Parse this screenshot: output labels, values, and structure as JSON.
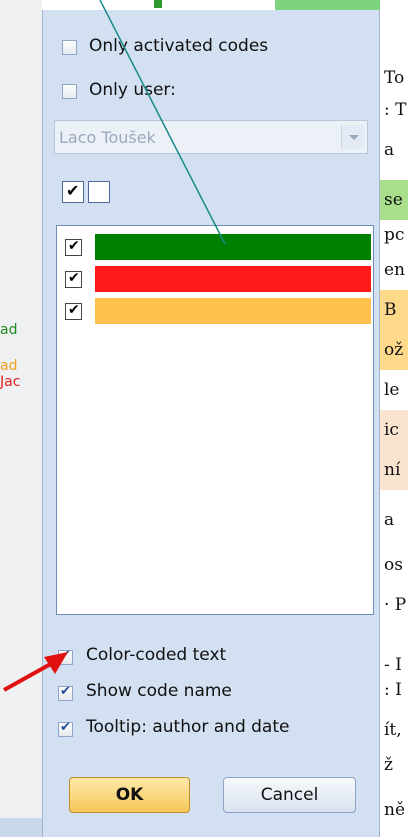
{
  "filters": {
    "only_activated_label": "Only activated codes",
    "only_user_label": "Only user:",
    "user_value": "Laco Toušek"
  },
  "code_list": [
    {
      "color": "#008000",
      "checked": true
    },
    {
      "color": "#ff1a1a",
      "checked": true
    },
    {
      "color": "#ffc04d",
      "checked": true
    }
  ],
  "options": {
    "color_coded_label": "Color-coded text",
    "show_code_name_label": "Show code name",
    "tooltip_label": "Tooltip: author and date"
  },
  "buttons": {
    "ok_label": "OK",
    "cancel_label": "Cancel"
  },
  "background": {
    "left_fragments": [
      {
        "text": "ad",
        "color": "#1f8a1f"
      },
      {
        "text": "ad",
        "color": "#f0a020"
      },
      {
        "text": "Jac",
        "color": "#e02020"
      }
    ],
    "right_fragments": [
      "To",
      ": T",
      "a",
      "se",
      "pc",
      "en",
      "B",
      "ož",
      "le",
      "ic",
      "ní",
      "a",
      "os",
      "· P",
      "- I",
      ": I",
      "ít,",
      "ž",
      "ně"
    ]
  },
  "annotation_colors": {
    "line": "#1a8a8a",
    "arrow": "#e01010"
  }
}
